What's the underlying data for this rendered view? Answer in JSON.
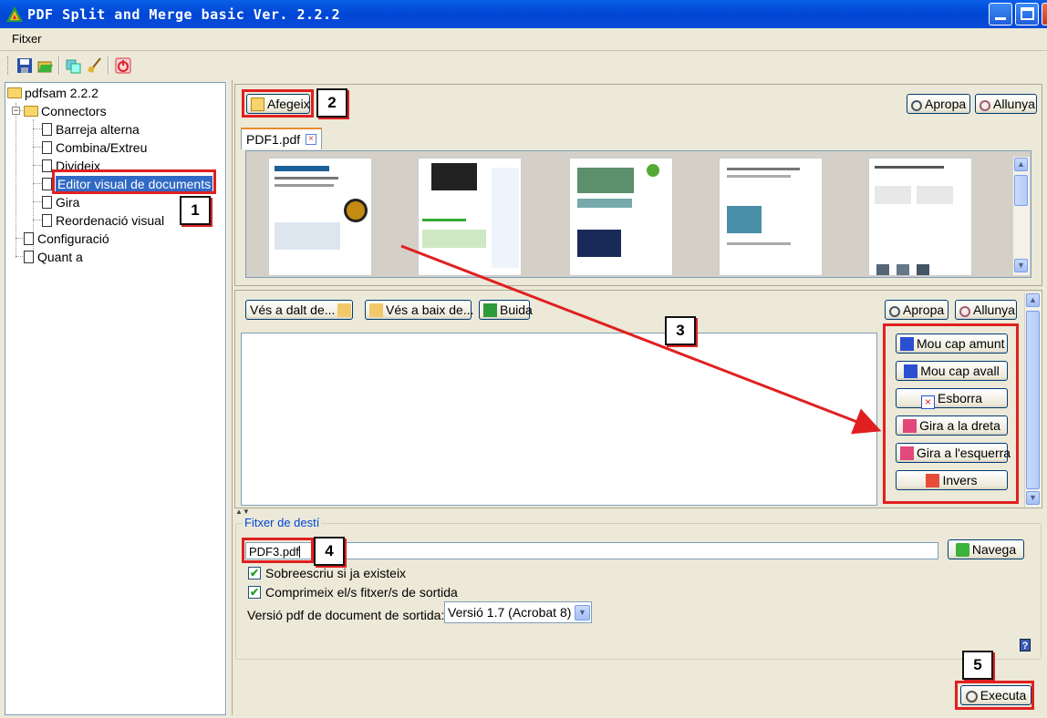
{
  "window": {
    "title": "PDF Split and Merge basic Ver. 2.2.2"
  },
  "menu": {
    "file": "Fitxer"
  },
  "tree": {
    "root": "pdfsam 2.2.2",
    "connectors": "Connectors",
    "items": [
      "Barreja alterna",
      "Combina/Extreu",
      "Divideix",
      "Editor visual de documents",
      "Gira",
      "Reordenació visual"
    ],
    "config": "Configuració",
    "about": "Quant a"
  },
  "top": {
    "add": "Afegeix",
    "zoom_in": "Apropa",
    "zoom_out": "Allunya",
    "tab": "PDF1.pdf"
  },
  "mid": {
    "go_top": "Vés a dalt de...",
    "go_bottom": "Vés a baix de...",
    "clear": "Buida",
    "zoom_in": "Apropa",
    "zoom_out": "Allunya",
    "actions": [
      "Mou cap amunt",
      "Mou cap avall",
      "Esborra",
      "Gira a la dreta",
      "Gira a l'esquerra",
      "Invers"
    ]
  },
  "dest": {
    "legend": "Fitxer de destí",
    "filename": "PDF3.pdf",
    "browse": "Navega",
    "overwrite": "Sobreescriu si ja existeix",
    "compress": "Comprimeix el/s fitxer/s de sortida",
    "version_label": "Versió pdf de document de sortida:",
    "version_value": "Versió 1.7 (Acrobat 8)",
    "help": "?"
  },
  "run": {
    "label": "Executa"
  },
  "annotations": [
    "1",
    "2",
    "3",
    "4",
    "5"
  ],
  "colors": {
    "highlight": "#e02020",
    "selection": "#316ac5",
    "titlebar": "#0046d5"
  }
}
